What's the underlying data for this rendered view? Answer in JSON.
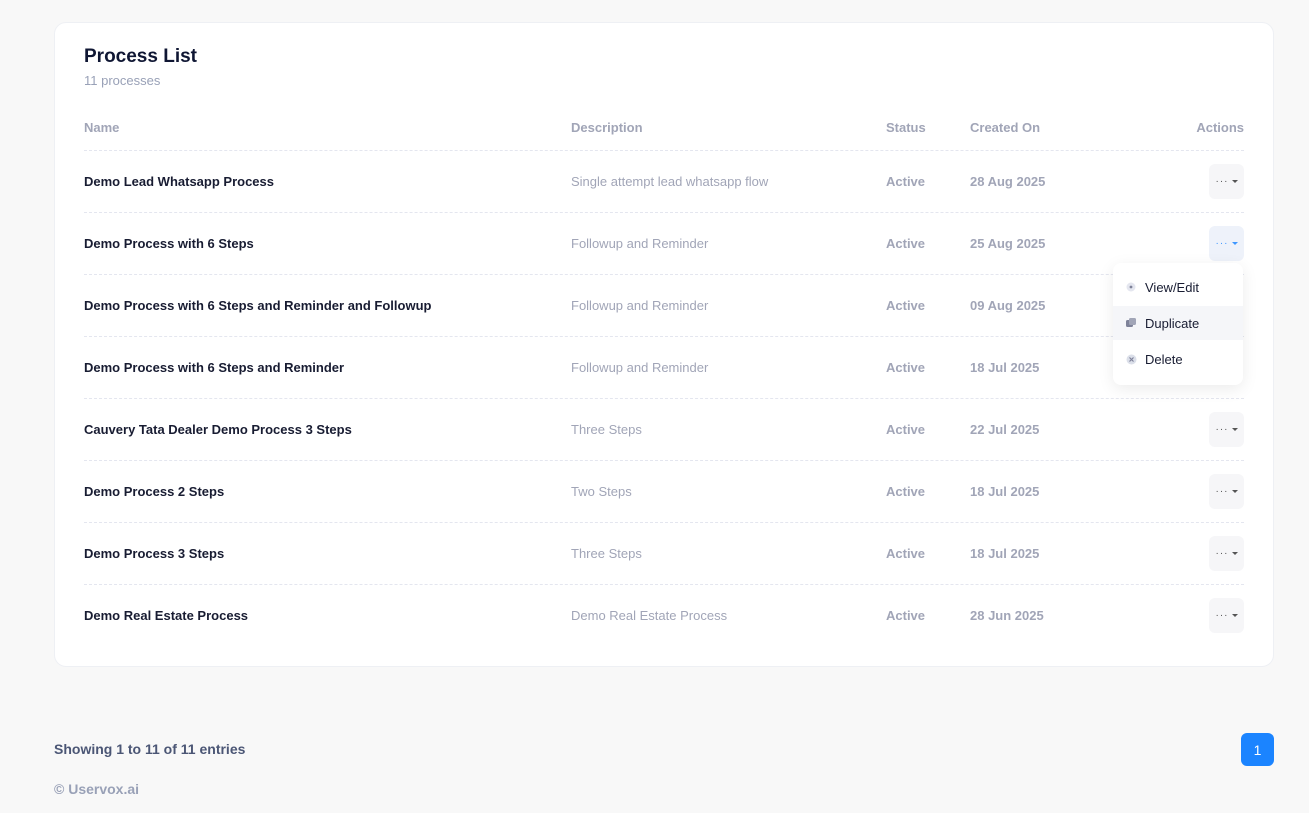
{
  "card": {
    "title": "Process List",
    "subtitle": "11 processes"
  },
  "table": {
    "headers": {
      "name": "Name",
      "description": "Description",
      "status": "Status",
      "created": "Created On",
      "actions": "Actions"
    },
    "rows": [
      {
        "name": "Demo Lead Whatsapp Process",
        "description": "Single attempt lead whatsapp flow",
        "status": "Active",
        "created": "28 Aug 2025"
      },
      {
        "name": "Demo Process with 6 Steps",
        "description": "Followup and Reminder",
        "status": "Active",
        "created": "25 Aug 2025"
      },
      {
        "name": "Demo Process with 6 Steps and Reminder and Followup",
        "description": "Followup and Reminder",
        "status": "Active",
        "created": "09 Aug 2025"
      },
      {
        "name": "Demo Process with 6 Steps and Reminder",
        "description": "Followup and Reminder",
        "status": "Active",
        "created": "18 Jul 2025"
      },
      {
        "name": "Cauvery Tata Dealer Demo Process 3 Steps",
        "description": "Three Steps",
        "status": "Active",
        "created": "22 Jul 2025"
      },
      {
        "name": "Demo Process 2 Steps",
        "description": "Two Steps",
        "status": "Active",
        "created": "18 Jul 2025"
      },
      {
        "name": "Demo Process 3 Steps",
        "description": "Three Steps",
        "status": "Active",
        "created": "18 Jul 2025"
      },
      {
        "name": "Demo Real Estate Process",
        "description": "Demo Real Estate Process",
        "status": "Active",
        "created": "28 Jun 2025"
      }
    ]
  },
  "menu": {
    "view_edit": "View/Edit",
    "duplicate": "Duplicate",
    "delete": "Delete"
  },
  "footer": {
    "showing": "Showing 1 to 11 of 11 entries",
    "page": "1",
    "copyright": "© Uservox.ai"
  },
  "icons": {
    "actions": "ellipsis-icon",
    "caret": "chevron-down-icon",
    "view": "eye-icon",
    "duplicate": "copy-icon",
    "delete": "close-circle-icon"
  },
  "colors": {
    "primary": "#1b84ff",
    "muted": "#a1a5b7",
    "text": "#181c32"
  }
}
